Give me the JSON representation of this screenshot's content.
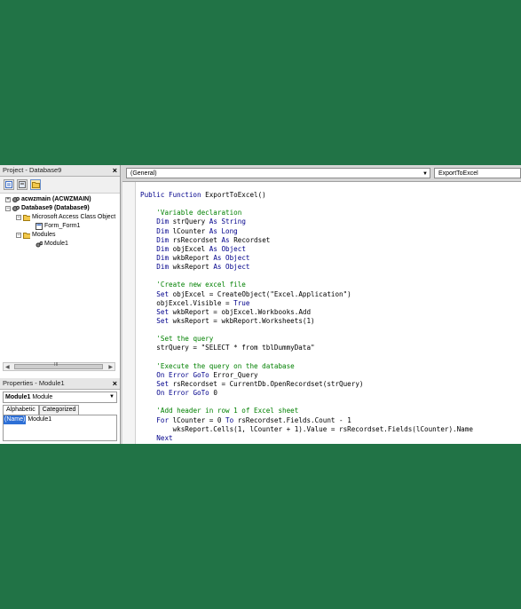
{
  "project_pane": {
    "title": "Project - Database9",
    "close": "×",
    "tree": [
      {
        "label": "acwzmain (ACWZMAIN)",
        "expander": "+",
        "bold": true
      },
      {
        "label": "Database9 (Database9)",
        "expander": "−",
        "bold": true
      },
      {
        "label": "Microsoft Access Class Object",
        "expander": "−",
        "bold": false
      },
      {
        "label": "Form_Form1",
        "expander": "",
        "bold": false
      },
      {
        "label": "Modules",
        "expander": "−",
        "bold": false
      },
      {
        "label": "Module1",
        "expander": "",
        "bold": false
      }
    ],
    "scroll_mid": "III"
  },
  "properties_pane": {
    "title": "Properties - Module1",
    "close": "×",
    "object_name": "Module1",
    "object_type": "Module",
    "tabs": [
      "Alphabetic",
      "Categorized"
    ],
    "prop_name": "(Name)",
    "prop_value": "Module1"
  },
  "code_window": {
    "object_combo": "(General)",
    "proc_combo": "ExportToExcel",
    "code_lines": [
      [
        [
          "k",
          "Public Function "
        ],
        [
          "t",
          "ExportToExcel()"
        ]
      ],
      [],
      [
        [
          "t",
          "    "
        ],
        [
          "c",
          "'Variable declaration"
        ]
      ],
      [
        [
          "t",
          "    "
        ],
        [
          "k",
          "Dim "
        ],
        [
          "t",
          "strQuery "
        ],
        [
          "k",
          "As String"
        ]
      ],
      [
        [
          "t",
          "    "
        ],
        [
          "k",
          "Dim "
        ],
        [
          "t",
          "lCounter "
        ],
        [
          "k",
          "As Long"
        ]
      ],
      [
        [
          "t",
          "    "
        ],
        [
          "k",
          "Dim "
        ],
        [
          "t",
          "rsRecordset "
        ],
        [
          "k",
          "As "
        ],
        [
          "t",
          "Recordset"
        ]
      ],
      [
        [
          "t",
          "    "
        ],
        [
          "k",
          "Dim "
        ],
        [
          "t",
          "objExcel "
        ],
        [
          "k",
          "As Object"
        ]
      ],
      [
        [
          "t",
          "    "
        ],
        [
          "k",
          "Dim "
        ],
        [
          "t",
          "wkbReport "
        ],
        [
          "k",
          "As Object"
        ]
      ],
      [
        [
          "t",
          "    "
        ],
        [
          "k",
          "Dim "
        ],
        [
          "t",
          "wksReport "
        ],
        [
          "k",
          "As Object"
        ]
      ],
      [],
      [
        [
          "t",
          "    "
        ],
        [
          "c",
          "'Create new excel file"
        ]
      ],
      [
        [
          "t",
          "    "
        ],
        [
          "k",
          "Set "
        ],
        [
          "t",
          "objExcel = CreateObject(\"Excel.Application\")"
        ]
      ],
      [
        [
          "t",
          "    objExcel.Visible = "
        ],
        [
          "k",
          "True"
        ]
      ],
      [
        [
          "t",
          "    "
        ],
        [
          "k",
          "Set "
        ],
        [
          "t",
          "wkbReport = objExcel.Workbooks.Add"
        ]
      ],
      [
        [
          "t",
          "    "
        ],
        [
          "k",
          "Set "
        ],
        [
          "t",
          "wksReport = wkbReport.Worksheets(1)"
        ]
      ],
      [],
      [
        [
          "t",
          "    "
        ],
        [
          "c",
          "'Set the query"
        ]
      ],
      [
        [
          "t",
          "    strQuery = \"SELECT * from tblDummyData\""
        ]
      ],
      [],
      [
        [
          "t",
          "    "
        ],
        [
          "c",
          "'Execute the query on the database"
        ]
      ],
      [
        [
          "t",
          "    "
        ],
        [
          "k",
          "On Error GoTo "
        ],
        [
          "t",
          "Error_Query"
        ]
      ],
      [
        [
          "t",
          "    "
        ],
        [
          "k",
          "Set "
        ],
        [
          "t",
          "rsRecordset = CurrentDb.OpenRecordset(strQuery)"
        ]
      ],
      [
        [
          "t",
          "    "
        ],
        [
          "k",
          "On Error GoTo "
        ],
        [
          "t",
          "0"
        ]
      ],
      [],
      [
        [
          "t",
          "    "
        ],
        [
          "c",
          "'Add header in row 1 of Excel sheet"
        ]
      ],
      [
        [
          "t",
          "    "
        ],
        [
          "k",
          "For "
        ],
        [
          "t",
          "lCounter = 0 "
        ],
        [
          "k",
          "To "
        ],
        [
          "t",
          "rsRecordset.Fields.Count - 1"
        ]
      ],
      [
        [
          "t",
          "        wksReport.Cells(1, lCounter + 1).Value = rsRecordset.Fields(lCounter).Name"
        ]
      ],
      [
        [
          "t",
          "    "
        ],
        [
          "k",
          "Next"
        ]
      ]
    ]
  },
  "colors": {
    "background": "#217346",
    "keyword": "#00008b",
    "comment": "#008000",
    "selection": "#2d6fd6"
  }
}
